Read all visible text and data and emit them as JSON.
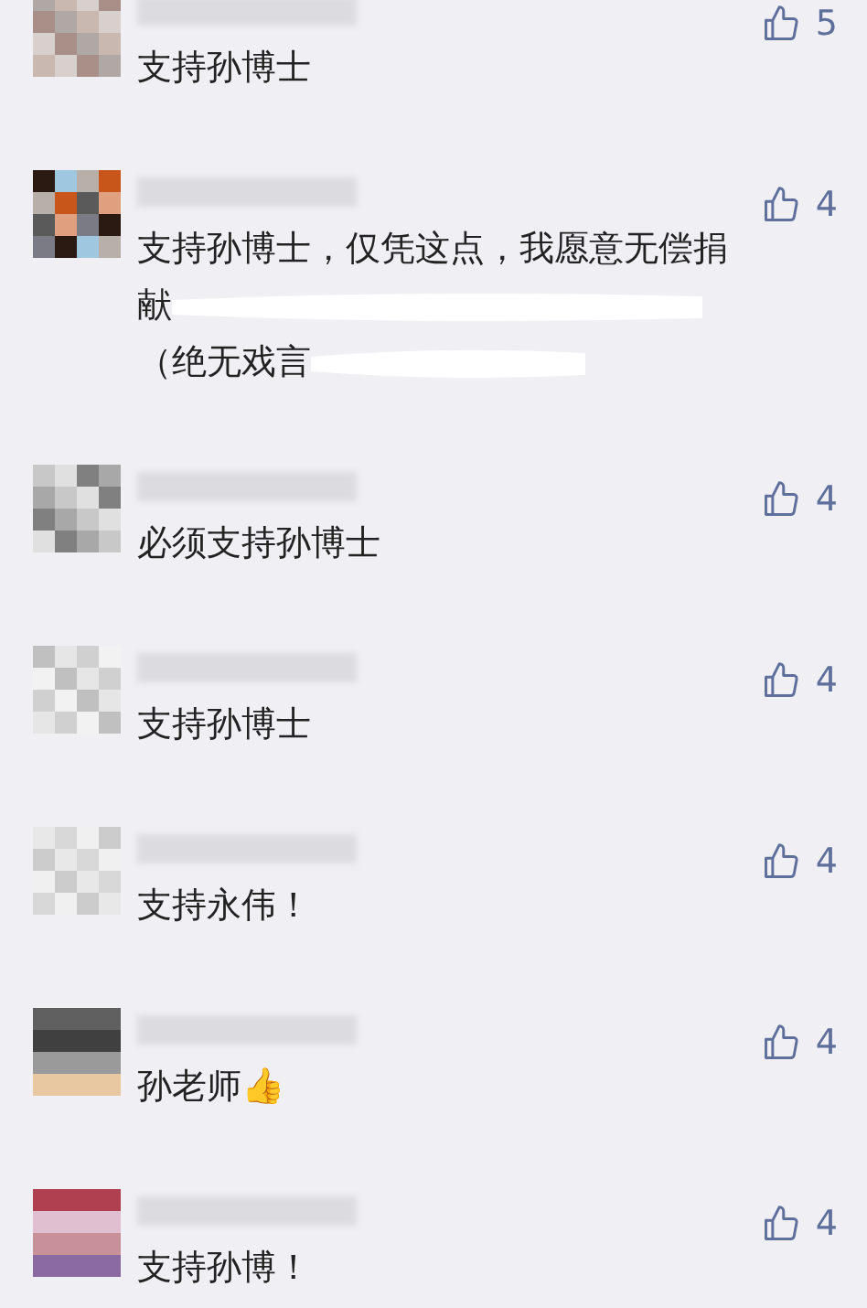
{
  "comments": [
    {
      "likes": "5",
      "lines": [
        {
          "text": "支持孙博士",
          "redacted": false
        }
      ]
    },
    {
      "likes": "4",
      "lines": [
        {
          "text": "支持孙博士，仅凭这点，我愿意无偿捐",
          "redacted": false
        },
        {
          "text": "献",
          "redacted": true
        },
        {
          "text": "（绝无戏言",
          "redacted": true
        }
      ]
    },
    {
      "likes": "4",
      "lines": [
        {
          "text": "必须支持孙博士",
          "redacted": false
        }
      ]
    },
    {
      "likes": "4",
      "lines": [
        {
          "text": "支持孙博士",
          "redacted": false
        }
      ]
    },
    {
      "likes": "4",
      "lines": [
        {
          "text": "支持永伟！",
          "redacted": false
        }
      ]
    },
    {
      "likes": "4",
      "lines": [
        {
          "text": "孙老师👍",
          "redacted": false
        }
      ]
    },
    {
      "likes": "4",
      "lines": [
        {
          "text": "支持孙博！",
          "redacted": false
        }
      ]
    }
  ]
}
